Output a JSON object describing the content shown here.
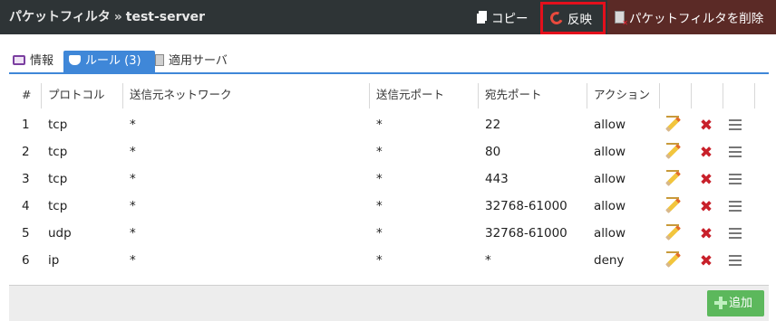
{
  "header": {
    "breadcrumb_root": "パケットフィルタ",
    "breadcrumb_sep": "»",
    "breadcrumb_current": "test-server",
    "copy_label": "コピー",
    "apply_label": "反映",
    "delete_label": "パケットフィルタを削除"
  },
  "tabs": [
    {
      "label": "情報"
    },
    {
      "label": "ルール (3)"
    },
    {
      "label": "適用サーバ"
    }
  ],
  "table": {
    "headers": [
      "#",
      "プロトコル",
      "送信元ネットワーク",
      "送信元ポート",
      "宛先ポート",
      "アクション"
    ],
    "rows": [
      {
        "num": "1",
        "protocol": "tcp",
        "source_network": "*",
        "source_port": "*",
        "dest_port": "22",
        "action": "allow"
      },
      {
        "num": "2",
        "protocol": "tcp",
        "source_network": "*",
        "source_port": "*",
        "dest_port": "80",
        "action": "allow"
      },
      {
        "num": "3",
        "protocol": "tcp",
        "source_network": "*",
        "source_port": "*",
        "dest_port": "443",
        "action": "allow"
      },
      {
        "num": "4",
        "protocol": "tcp",
        "source_network": "*",
        "source_port": "*",
        "dest_port": "32768-61000",
        "action": "allow"
      },
      {
        "num": "5",
        "protocol": "udp",
        "source_network": "*",
        "source_port": "*",
        "dest_port": "32768-61000",
        "action": "allow"
      },
      {
        "num": "6",
        "protocol": "ip",
        "source_network": "*",
        "source_port": "*",
        "dest_port": "*",
        "action": "deny"
      }
    ]
  },
  "footer": {
    "add_label": "追加"
  },
  "colors": {
    "header_bg": "#2e3436",
    "highlight": "#e3101c",
    "tab_active": "#3f87d8",
    "add_button": "#5cb85c"
  }
}
